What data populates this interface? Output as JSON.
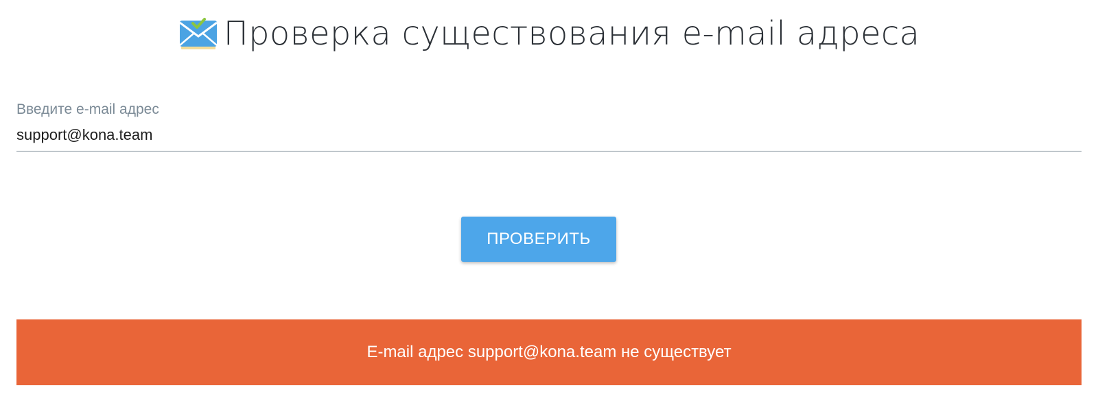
{
  "header": {
    "icon": "envelope-check-icon",
    "title": "Проверка существования e-mail адреса"
  },
  "form": {
    "label": "Введите e-mail адрес",
    "email_value": "support@kona.team",
    "submit_label": "ПРОВЕРИТЬ"
  },
  "result": {
    "message": "E-mail адрес support@kona.team не существует"
  },
  "colors": {
    "accent": "#4da6ea",
    "error": "#e96538",
    "label": "#7b8a96",
    "title": "#2b3036"
  }
}
